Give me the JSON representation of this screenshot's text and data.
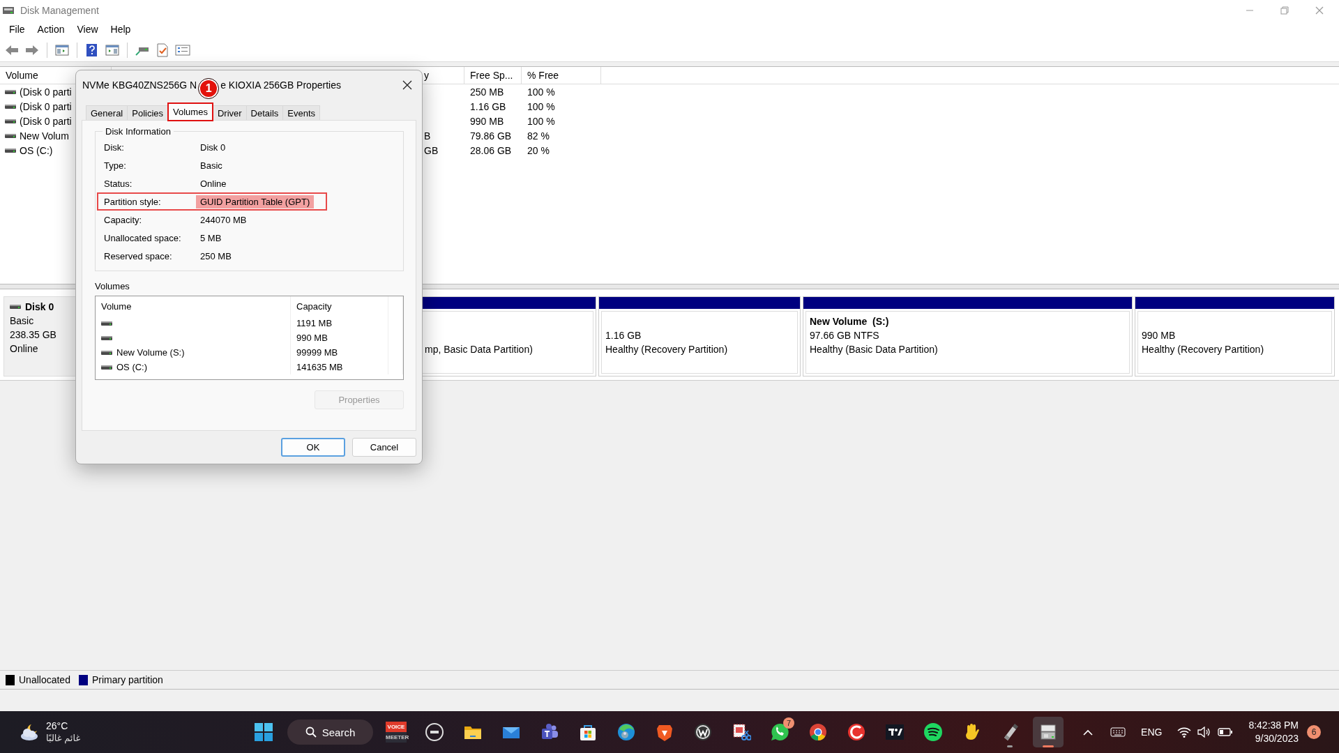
{
  "window": {
    "title": "Disk Management"
  },
  "menu": [
    "File",
    "Action",
    "View",
    "Help"
  ],
  "volume_table": {
    "columns": [
      "Volume",
      "y",
      "Free Sp...",
      "% Free"
    ],
    "rows": [
      {
        "volume": "(Disk 0 parti",
        "free_space": "250 MB",
        "percent_free": "100 %"
      },
      {
        "volume": "(Disk 0 parti",
        "free_space": "1.16 GB",
        "percent_free": "100 %"
      },
      {
        "volume": "(Disk 0 parti",
        "free_space": "990 MB",
        "percent_free": "100 %"
      },
      {
        "volume": "New Volum",
        "column_2": "B",
        "free_space": "79.86 GB",
        "percent_free": "82 %"
      },
      {
        "volume": "OS (C:)",
        "column_2": "GB",
        "free_space": "28.06 GB",
        "percent_free": "20 %"
      }
    ]
  },
  "disk_map": {
    "disk": {
      "name": "Disk 0",
      "type": "Basic",
      "size": "238.35 GB",
      "status": "Online"
    },
    "partitions": [
      {
        "status": "mp, Basic Data Partition)"
      },
      {
        "size": "1.16 GB",
        "status": "Healthy (Recovery Partition)"
      },
      {
        "name": "New Volume  (S:)",
        "size": "97.66 GB NTFS",
        "status": "Healthy (Basic Data Partition)"
      },
      {
        "size": "990 MB",
        "status": "Healthy (Recovery Partition)"
      }
    ]
  },
  "legend": [
    {
      "label": "Unallocated",
      "color": "#000000"
    },
    {
      "label": "Primary partition",
      "color": "#000080"
    }
  ],
  "dialog": {
    "title_parts": [
      "NVMe KBG40ZNS256G N",
      "e KIOXIA 256GB Properties"
    ],
    "callout": {
      "label": "1"
    },
    "tabs": [
      {
        "label": "General",
        "selected": false,
        "outlined": false
      },
      {
        "label": "Policies",
        "selected": false,
        "outlined": false
      },
      {
        "label": "Volumes",
        "selected": true,
        "outlined": true
      },
      {
        "label": "Driver",
        "selected": false,
        "outlined": false
      },
      {
        "label": "Details",
        "selected": false,
        "outlined": false
      },
      {
        "label": "Events",
        "selected": false,
        "outlined": false
      }
    ],
    "disk_information": {
      "heading": "Disk Information",
      "rows": [
        {
          "label": "Disk:",
          "value": "Disk 0",
          "highlighted": false
        },
        {
          "label": "Type:",
          "value": "Basic",
          "highlighted": false
        },
        {
          "label": "Status:",
          "value": "Online",
          "highlighted": false
        },
        {
          "label": "Partition style:",
          "value": "GUID Partition Table (GPT)",
          "highlighted": true
        },
        {
          "label": "Capacity:",
          "value": "244070 MB",
          "highlighted": false
        },
        {
          "label": "Unallocated space:",
          "value": "5 MB",
          "highlighted": false
        },
        {
          "label": "Reserved space:",
          "value": "250 MB",
          "highlighted": false
        }
      ]
    },
    "volumes": {
      "heading": "Volumes",
      "columns": [
        "Volume",
        "Capacity"
      ],
      "rows": [
        {
          "capacity": "1191 MB"
        },
        {
          "capacity": "990 MB"
        },
        {
          "name": "New Volume (S:)",
          "capacity": "99999 MB"
        },
        {
          "name": "OS (C:)",
          "capacity": "141635 MB"
        }
      ],
      "properties_button": {
        "label": "Properties",
        "disabled": true
      }
    },
    "buttons": [
      {
        "label": "OK",
        "default": true
      },
      {
        "label": "Cancel",
        "default": false
      }
    ]
  },
  "taskbar": {
    "weather": {
      "temperature": "26°C",
      "condition": "غائم غالبًا"
    },
    "search": {
      "label": "Search"
    },
    "apps": [
      {
        "kind": "voice",
        "texts": [
          "VOICE",
          "MEETER"
        ],
        "running": false,
        "active": false
      },
      {
        "kind": "round-logo",
        "running": false,
        "active": false
      },
      {
        "kind": "folder",
        "running": false,
        "active": false
      },
      {
        "kind": "mail",
        "running": false,
        "active": false
      },
      {
        "kind": "team-chat",
        "running": false,
        "active": false
      },
      {
        "kind": "store",
        "running": false,
        "active": false
      },
      {
        "kind": "browser-swirl",
        "running": false,
        "active": false
      },
      {
        "kind": "shield",
        "running": false,
        "active": false
      },
      {
        "kind": "ring",
        "running": false,
        "active": false
      },
      {
        "kind": "snip",
        "running": false,
        "active": false
      },
      {
        "kind": "chat",
        "badge": "7",
        "running": false,
        "active": false
      },
      {
        "kind": "browser-ball",
        "running": false,
        "active": false
      },
      {
        "kind": "swirl",
        "running": false,
        "active": false
      },
      {
        "kind": "chart-logo",
        "running": false,
        "active": false
      },
      {
        "kind": "music",
        "running": false,
        "active": false
      },
      {
        "kind": "hand",
        "running": false,
        "active": false
      },
      {
        "kind": "usb",
        "running": true,
        "active": false
      },
      {
        "kind": "disk-tool",
        "running": true,
        "active": true
      }
    ],
    "tray": {
      "language": "ENG",
      "time": "8:42:38 PM",
      "date": "9/30/2023",
      "notifications": "6"
    }
  }
}
